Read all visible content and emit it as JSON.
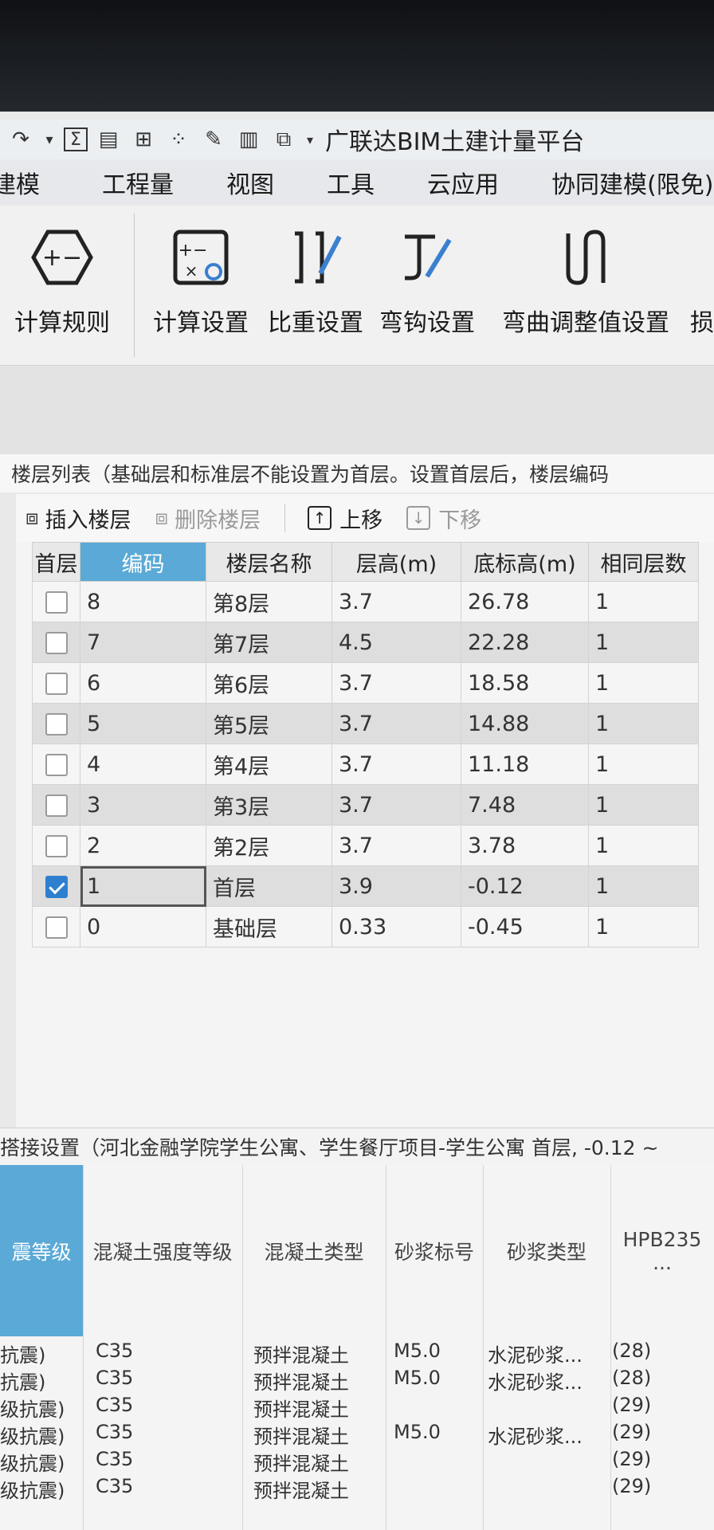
{
  "app": {
    "title": "广联达BIM土建计量平台",
    "quick_icons": [
      "redo-icon",
      "dropdown-icon",
      "sum-icon",
      "report-icon",
      "grid-view-icon",
      "select-icon",
      "edit-icon",
      "column-icon",
      "code-icon"
    ]
  },
  "menu": [
    "建模",
    "工程量",
    "视图",
    "工具",
    "云应用",
    "协同建模(限免)"
  ],
  "ribbon": {
    "buttons": [
      "计算规则",
      "计算设置",
      "比重设置",
      "弯钩设置",
      "弯曲调整值设置",
      "损"
    ]
  },
  "floor_panel": {
    "title": "楼层列表（基础层和标准层不能设置为首层。设置首层后，楼层编码",
    "toolbar": {
      "insert": "插入楼层",
      "delete": "删除楼层",
      "up": "上移",
      "down": "下移"
    },
    "columns": [
      "首层",
      "编码",
      "楼层名称",
      "层高(m)",
      "底标高(m)",
      "相同层数"
    ],
    "rows": [
      {
        "first": false,
        "code": "8",
        "name": "第8层",
        "height": "3.7",
        "bottom": "26.78",
        "same": "1"
      },
      {
        "first": false,
        "code": "7",
        "name": "第7层",
        "height": "4.5",
        "bottom": "22.28",
        "same": "1"
      },
      {
        "first": false,
        "code": "6",
        "name": "第6层",
        "height": "3.7",
        "bottom": "18.58",
        "same": "1"
      },
      {
        "first": false,
        "code": "5",
        "name": "第5层",
        "height": "3.7",
        "bottom": "14.88",
        "same": "1"
      },
      {
        "first": false,
        "code": "4",
        "name": "第4层",
        "height": "3.7",
        "bottom": "11.18",
        "same": "1"
      },
      {
        "first": false,
        "code": "3",
        "name": "第3层",
        "height": "3.7",
        "bottom": "7.48",
        "same": "1"
      },
      {
        "first": false,
        "code": "2",
        "name": "第2层",
        "height": "3.7",
        "bottom": "3.78",
        "same": "1"
      },
      {
        "first": true,
        "code": "1",
        "name": "首层",
        "height": "3.9",
        "bottom": "-0.12",
        "same": "1"
      },
      {
        "first": false,
        "code": "0",
        "name": "基础层",
        "height": "0.33",
        "bottom": "-0.45",
        "same": "1"
      }
    ]
  },
  "lower_panel": {
    "title": "搭接设置（河北金融学院学生公寓、学生餐厅项目-学生公寓  首层, -0.12 ~",
    "columns": [
      "震等级",
      "混凝土强度等级",
      "混凝土类型",
      "砂浆标号",
      "砂浆类型",
      "HPB235\n..."
    ],
    "rows": [
      {
        "grade": "抗震)",
        "strength": "C35",
        "type": "预拌混凝土",
        "mortar": "M5.0",
        "mortar_type": "水泥砂浆...",
        "hpb": "(28)"
      },
      {
        "grade": "抗震)",
        "strength": "C35",
        "type": "预拌混凝土",
        "mortar": "M5.0",
        "mortar_type": "水泥砂浆...",
        "hpb": "(28)"
      },
      {
        "grade": "级抗震)",
        "strength": "C35",
        "type": "预拌混凝土",
        "mortar": "",
        "mortar_type": "",
        "hpb": "(29)"
      },
      {
        "grade": "级抗震)",
        "strength": "C35",
        "type": "预拌混凝土",
        "mortar": "M5.0",
        "mortar_type": "水泥砂浆...",
        "hpb": "(29)"
      },
      {
        "grade": "级抗震)",
        "strength": "C35",
        "type": "预拌混凝土",
        "mortar": "",
        "mortar_type": "",
        "hpb": "(29)"
      },
      {
        "grade": "级抗震)",
        "strength": "C35",
        "type": "预拌混凝土",
        "mortar": "",
        "mortar_type": "",
        "hpb": "(29)"
      }
    ]
  },
  "colors": {
    "header_selected": "#5aa9d6",
    "checkbox_checked": "#2f7fd0"
  }
}
